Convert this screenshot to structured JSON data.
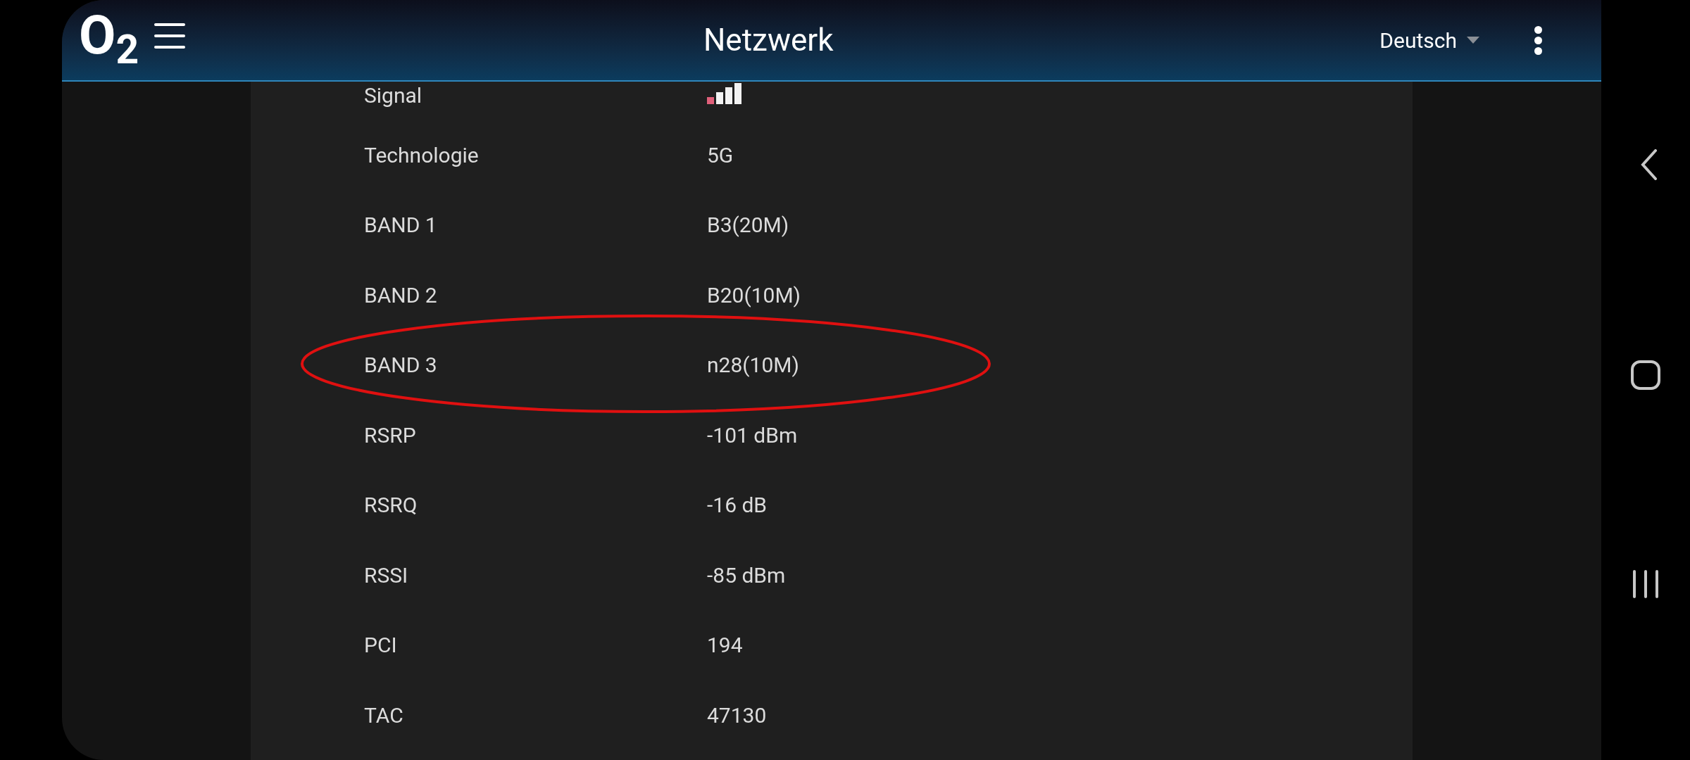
{
  "header": {
    "logo": "O$_{2}$",
    "title": "Netzwerk",
    "language": "Deutsch"
  },
  "rows": [
    {
      "label": "Signal",
      "kind": "signal"
    },
    {
      "label": "Technologie",
      "kind": "text",
      "value": "5G"
    },
    {
      "label": "BAND 1",
      "kind": "text",
      "value": "B3(20M)"
    },
    {
      "label": "BAND 2",
      "kind": "text",
      "value": "B20(10M)"
    },
    {
      "label": "BAND 3",
      "kind": "text",
      "value": "n28(10M)"
    },
    {
      "label": "RSRP",
      "kind": "text",
      "value": "-101 dBm"
    },
    {
      "label": "RSRQ",
      "kind": "text",
      "value": "-16 dB"
    },
    {
      "label": "RSSI",
      "kind": "text",
      "value": "-85 dBm"
    },
    {
      "label": "PCI",
      "kind": "text",
      "value": "194"
    },
    {
      "label": "TAC",
      "kind": "text",
      "value": "47130"
    }
  ]
}
